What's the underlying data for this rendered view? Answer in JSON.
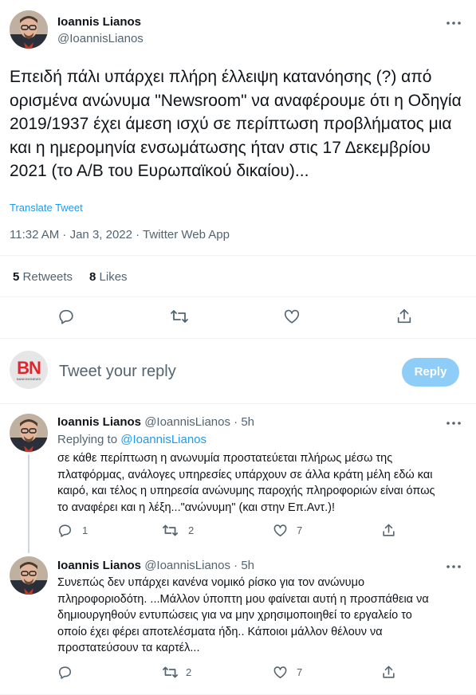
{
  "main_tweet": {
    "author_name": "Ioannis Lianos",
    "author_handle": "@IoannisLianos",
    "text": "Επειδή πάλι υπάρχει πλήρη έλλειψη κατανόησης (?) από ορισμένα ανώνυμα \"Newsroom\" να αναφέρουμε ότι η Οδηγία 2019/1937 έχει άμεση ισχύ σε περίπτωση προβλήματος μια και η ημερομηνία ενσωμάτωσης ήταν στις 17 Δεκεμβρίου 2021 (το Α/Β του Ευρωπαϊκού δικαίου)...",
    "translate_label": "Translate Tweet",
    "timestamp": "11:32 AM · Jan 3, 2022 · Twitter Web App",
    "retweets_count": "5",
    "retweets_label": "Retweets",
    "likes_count": "8",
    "likes_label": "Likes"
  },
  "composer": {
    "avatar_text": "BN",
    "avatar_subtext": "BANKINGNEWS",
    "placeholder": "Tweet your reply",
    "reply_button": "Reply"
  },
  "replies": [
    {
      "author_name": "Ioannis Lianos",
      "author_handle": "@IoannisLianos",
      "time": "· 5h",
      "replying_to_label": "Replying to",
      "replying_to_handle": "@IoannisLianos",
      "line1": "σε κάθε περίπτωση η ανωνυμία προστατεύεται πλήρως μέσω της",
      "line2": "πλατφόρμας, ανάλογες υπηρεσίες υπάρχουν σε άλλα κράτη μέλη εδώ και",
      "line3": "καιρό, και τέλος η υπηρεσία ανώνυμης παροχής πληροφοριών είναι όπως",
      "line4": "το αναφέρει και η λέξη...\"ανώνυμη\" (και στην Επ.Αντ.)!",
      "reply_count": "1",
      "retweet_count": "2",
      "like_count": "7"
    },
    {
      "author_name": "Ioannis Lianos",
      "author_handle": "@IoannisLianos",
      "time": "· 5h",
      "line1": "Συνεπώς δεν υπάρχει κανένα νομικό ρίσκο για τον ανώνυμο",
      "line2": "πληροφοριοδότη. ...Μάλλον ύποπτη μου φαίνεται αυτή η προσπάθεια να",
      "line3": "δημιουργηθούν εντυπώσεις για να μην χρησιμοποιηθεί το εργαλείο το",
      "line4": "οποίο έχει φέρει αποτελέσματα ήδη.. Κάποιοι μάλλον θέλουν να",
      "line5": "προστατεύσουν τα καρτέλ...",
      "reply_count": "",
      "retweet_count": "2",
      "like_count": "7"
    }
  ],
  "colors": {
    "accent": "#1d9bf0",
    "reply_button_disabled": "#8ecdf8",
    "muted_text": "#536471",
    "divider": "#eff3f4",
    "bn_red": "#e0262d"
  },
  "icons": [
    "more-icon",
    "reply-icon",
    "retweet-icon",
    "like-icon",
    "share-icon"
  ]
}
